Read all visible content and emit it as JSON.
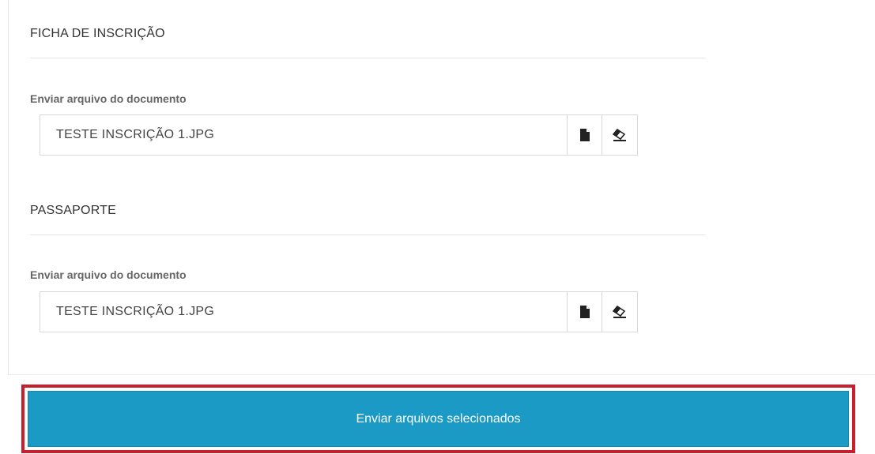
{
  "sections": [
    {
      "title": "FICHA DE INSCRIÇÃO",
      "field_label": "Enviar arquivo do documento",
      "file_value": "TESTE INSCRIÇÃO 1.JPG",
      "icons": {
        "browse": "file-icon",
        "clear": "eraser-icon"
      }
    },
    {
      "title": "PASSAPORTE",
      "field_label": "Enviar arquivo do documento",
      "file_value": "TESTE INSCRIÇÃO 1.JPG",
      "icons": {
        "browse": "file-icon",
        "clear": "eraser-icon"
      }
    }
  ],
  "submit": {
    "label": "Enviar arquivos selecionados",
    "color": "#1a9ac4",
    "highlight_color": "#c7202c"
  }
}
